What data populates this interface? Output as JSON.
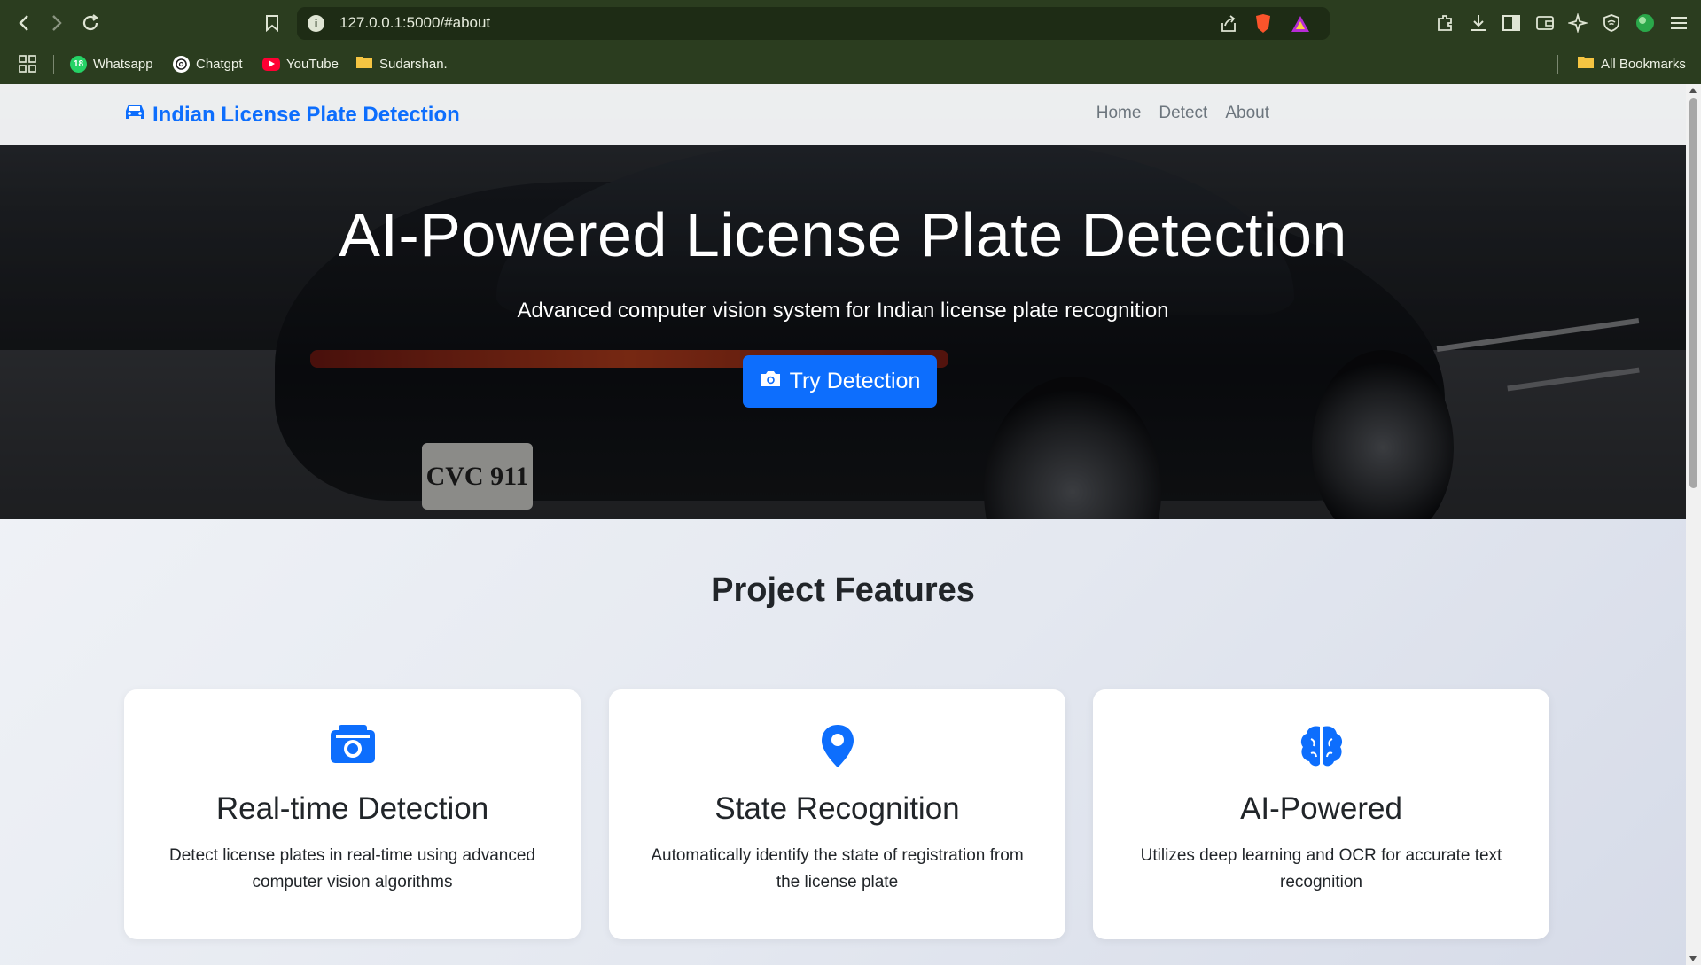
{
  "browser": {
    "url": "127.0.0.1:5000/#about",
    "bookmarks": [
      {
        "label": "Whatsapp",
        "icon": "whatsapp-icon",
        "color": "#25d366"
      },
      {
        "label": "Chatgpt",
        "icon": "chatgpt-icon",
        "color": "#ffffff"
      },
      {
        "label": "YouTube",
        "icon": "youtube-icon",
        "color": "#ff0033"
      },
      {
        "label": "Sudarshan.",
        "icon": "folder-icon",
        "color": "#f5c542"
      }
    ],
    "all_bookmarks": "All Bookmarks",
    "whatsapp_badge": "18"
  },
  "navbar": {
    "brand": "Indian License Plate Detection",
    "links": [
      "Home",
      "Detect",
      "About"
    ]
  },
  "hero": {
    "title": "AI-Powered License Plate Detection",
    "subtitle": "Advanced computer vision system for Indian license plate recognition",
    "button": "Try Detection",
    "plate_text": "CVC 911"
  },
  "features": {
    "title": "Project Features",
    "cards": [
      {
        "icon": "camera-icon",
        "title": "Real-time Detection",
        "text": "Detect license plates in real-time using advanced computer vision algorithms"
      },
      {
        "icon": "map-pin-icon",
        "title": "State Recognition",
        "text": "Automatically identify the state of registration from the license plate"
      },
      {
        "icon": "brain-icon",
        "title": "AI-Powered",
        "text": "Utilizes deep learning and OCR for accurate text recognition"
      }
    ]
  },
  "colors": {
    "accent": "#0d6efd",
    "chrome": "#2b3d1f"
  }
}
